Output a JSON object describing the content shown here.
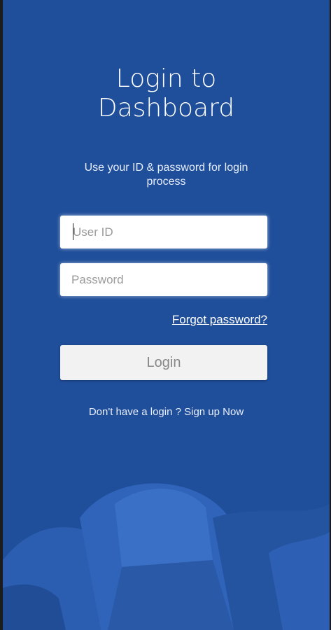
{
  "login": {
    "title": "Login to Dashboard",
    "subtitle": "Use your ID & password for login process",
    "user_id_placeholder": "User ID",
    "password_placeholder": "Password",
    "forgot_password": "Forgot password?",
    "login_button": "Login",
    "signup_prompt": "Don't have a login ? Sign up Now"
  },
  "colors": {
    "background": "#1f4e9a",
    "field_background": "#ffffff",
    "button_background": "#f2f2f2"
  },
  "decoration": {
    "background_art": "backpack-illustration"
  }
}
